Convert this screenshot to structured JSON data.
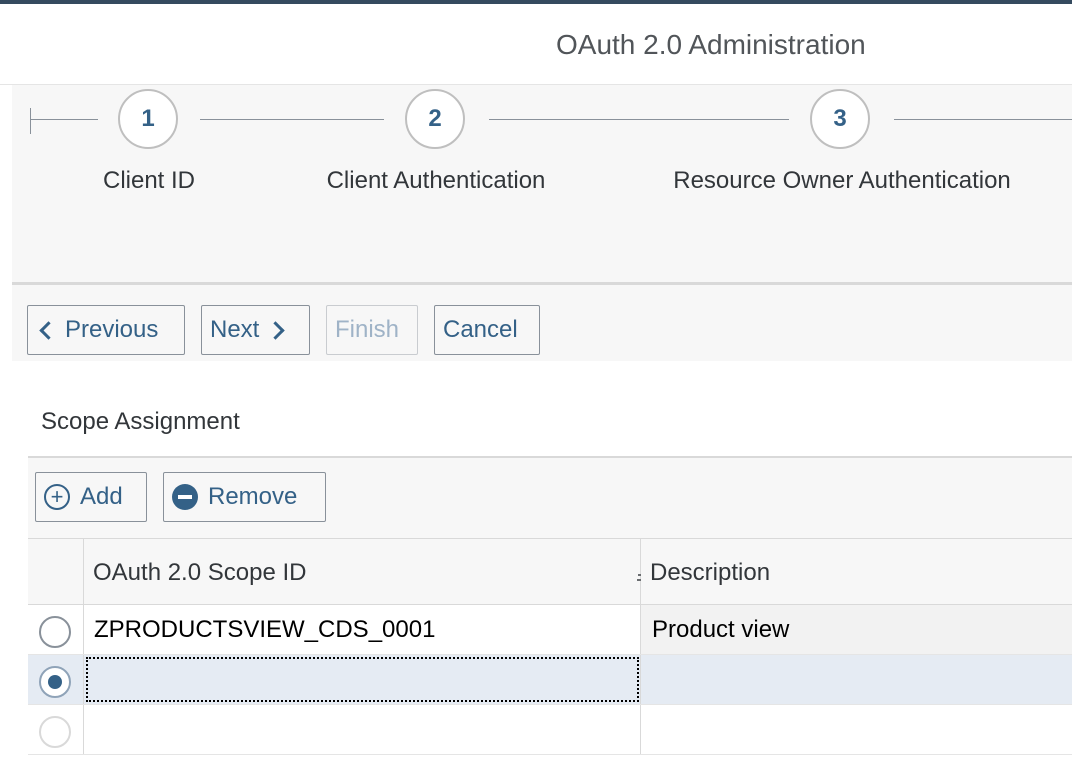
{
  "app": {
    "title": "OAuth 2.0 Administration"
  },
  "roadmap": {
    "steps": [
      {
        "number": "1",
        "label": "Client ID"
      },
      {
        "number": "2",
        "label": "Client Authentication"
      },
      {
        "number": "3",
        "label": "Resource Owner Authentication"
      }
    ]
  },
  "toolbar": {
    "previous_label": "Previous",
    "next_label": "Next",
    "finish_label": "Finish",
    "cancel_label": "Cancel"
  },
  "scope_section": {
    "title": "Scope Assignment",
    "add_label": "Add",
    "remove_label": "Remove",
    "columns": [
      "OAuth 2.0 Scope ID",
      "Description"
    ],
    "rows": [
      {
        "scope_id": "ZPRODUCTSVIEW_CDS_0001",
        "description": "Product view",
        "selected": false
      },
      {
        "scope_id": "",
        "description": "",
        "selected": true
      },
      {
        "scope_id": "",
        "description": "",
        "selected": false
      }
    ]
  },
  "colors": {
    "accent": "#346187",
    "shell_bar": "#354a5f",
    "background": "#f7f7f7",
    "selected_row": "#e5ebf3"
  },
  "icons": [
    "chevron-left-icon",
    "chevron-right-icon",
    "add-circle-icon",
    "remove-circle-icon",
    "sort-icon"
  ]
}
